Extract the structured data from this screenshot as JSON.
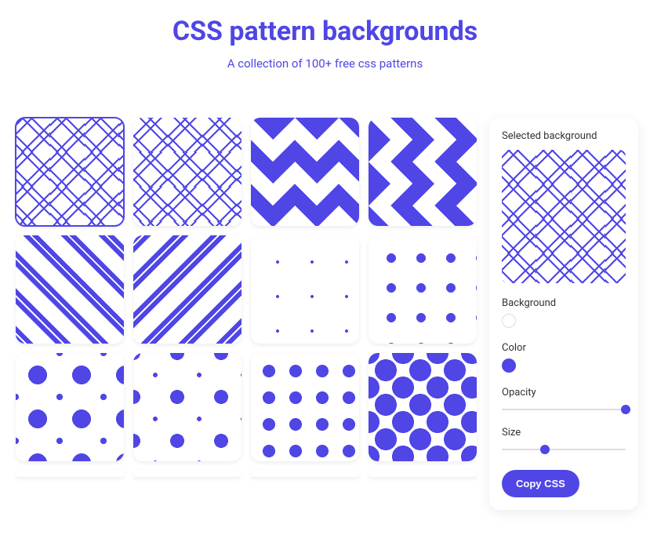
{
  "header": {
    "title": "CSS pattern backgrounds",
    "subtitle": "A collection of 100+ free css patterns"
  },
  "patterns": [
    {
      "id": "zigzag-outline-horizontal",
      "cls": "p-zigzag-outline",
      "selected": true
    },
    {
      "id": "zigzag-outline-vertical",
      "cls": "p-zigzag-vert-outline",
      "selected": false
    },
    {
      "id": "zigzag-solid-horizontal",
      "cls": "p-zigzag-solid",
      "selected": false
    },
    {
      "id": "zigzag-solid-vertical",
      "cls": "p-zigzag-vert-solid",
      "selected": false
    },
    {
      "id": "waves-diagonal-left",
      "cls": "p-wave-diag",
      "selected": false
    },
    {
      "id": "waves-diagonal-right",
      "cls": "p-wave-diag2",
      "selected": false
    },
    {
      "id": "dots-tiny",
      "cls": "p-dots-tiny",
      "selected": false
    },
    {
      "id": "dots-small",
      "cls": "p-dots-small",
      "selected": false
    },
    {
      "id": "dots-varied-large-small",
      "cls": "p-dots-varied",
      "selected": false
    },
    {
      "id": "dots-varied-small-large",
      "cls": "p-dots-varied-inv",
      "selected": false
    },
    {
      "id": "dots-medium-grid",
      "cls": "p-dots-med",
      "selected": false
    },
    {
      "id": "dots-large-dense",
      "cls": "p-dots-large",
      "selected": false
    }
  ],
  "panel": {
    "selected_label": "Selected background",
    "preview_cls": "p-zigzag-outline",
    "fields": {
      "background": {
        "label": "Background",
        "value": "#ffffff"
      },
      "color": {
        "label": "Color",
        "value": "#4f46e5"
      },
      "opacity": {
        "label": "Opacity",
        "value": 100
      },
      "size": {
        "label": "Size",
        "value": 35
      }
    },
    "copy_label": "Copy CSS"
  }
}
